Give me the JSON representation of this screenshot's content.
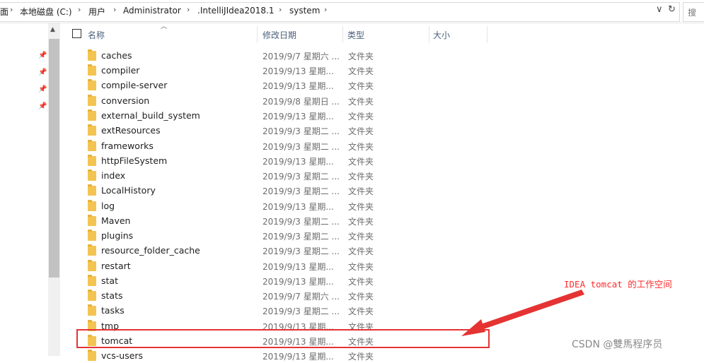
{
  "address_bar": {
    "crumbs": [
      "面",
      "本地磁盘 (C:)",
      "用户",
      "Administrator",
      ".IntelliJIdea2018.1",
      "system"
    ],
    "dropdown_icon": "chevron-down-icon",
    "refresh_icon": "refresh-icon",
    "search_placeholder": "搜"
  },
  "columns": {
    "name": "名称",
    "date": "修改日期",
    "type": "类型",
    "size": "大小"
  },
  "files": [
    {
      "name": "caches",
      "date": "2019/9/7 星期六 ...",
      "type": "文件夹"
    },
    {
      "name": "compiler",
      "date": "2019/9/13 星期...",
      "type": "文件夹"
    },
    {
      "name": "compile-server",
      "date": "2019/9/13 星期...",
      "type": "文件夹"
    },
    {
      "name": "conversion",
      "date": "2019/9/8 星期日 ...",
      "type": "文件夹"
    },
    {
      "name": "external_build_system",
      "date": "2019/9/13 星期...",
      "type": "文件夹"
    },
    {
      "name": "extResources",
      "date": "2019/9/3 星期二 ...",
      "type": "文件夹"
    },
    {
      "name": "frameworks",
      "date": "2019/9/3 星期二 ...",
      "type": "文件夹"
    },
    {
      "name": "httpFileSystem",
      "date": "2019/9/13 星期...",
      "type": "文件夹"
    },
    {
      "name": "index",
      "date": "2019/9/3 星期二 ...",
      "type": "文件夹"
    },
    {
      "name": "LocalHistory",
      "date": "2019/9/3 星期二 ...",
      "type": "文件夹"
    },
    {
      "name": "log",
      "date": "2019/9/13 星期...",
      "type": "文件夹"
    },
    {
      "name": "Maven",
      "date": "2019/9/3 星期二 ...",
      "type": "文件夹"
    },
    {
      "name": "plugins",
      "date": "2019/9/3 星期二 ...",
      "type": "文件夹"
    },
    {
      "name": "resource_folder_cache",
      "date": "2019/9/3 星期二 ...",
      "type": "文件夹"
    },
    {
      "name": "restart",
      "date": "2019/9/13 星期...",
      "type": "文件夹"
    },
    {
      "name": "stat",
      "date": "2019/9/13 星期...",
      "type": "文件夹"
    },
    {
      "name": "stats",
      "date": "2019/9/7 星期六 ...",
      "type": "文件夹"
    },
    {
      "name": "tasks",
      "date": "2019/9/3 星期二 ...",
      "type": "文件夹"
    },
    {
      "name": "tmp",
      "date": "2019/9/13 星期...",
      "type": "文件夹"
    },
    {
      "name": "tomcat",
      "date": "2019/9/13 星期...",
      "type": "文件夹"
    },
    {
      "name": "vcs-users",
      "date": "2019/9/13 星期...",
      "type": "文件夹"
    }
  ],
  "annotation": {
    "text": "IDEA tomcat 的工作空间",
    "color": "#ff2a2a"
  },
  "watermark": "CSDN @雙馬程序员"
}
